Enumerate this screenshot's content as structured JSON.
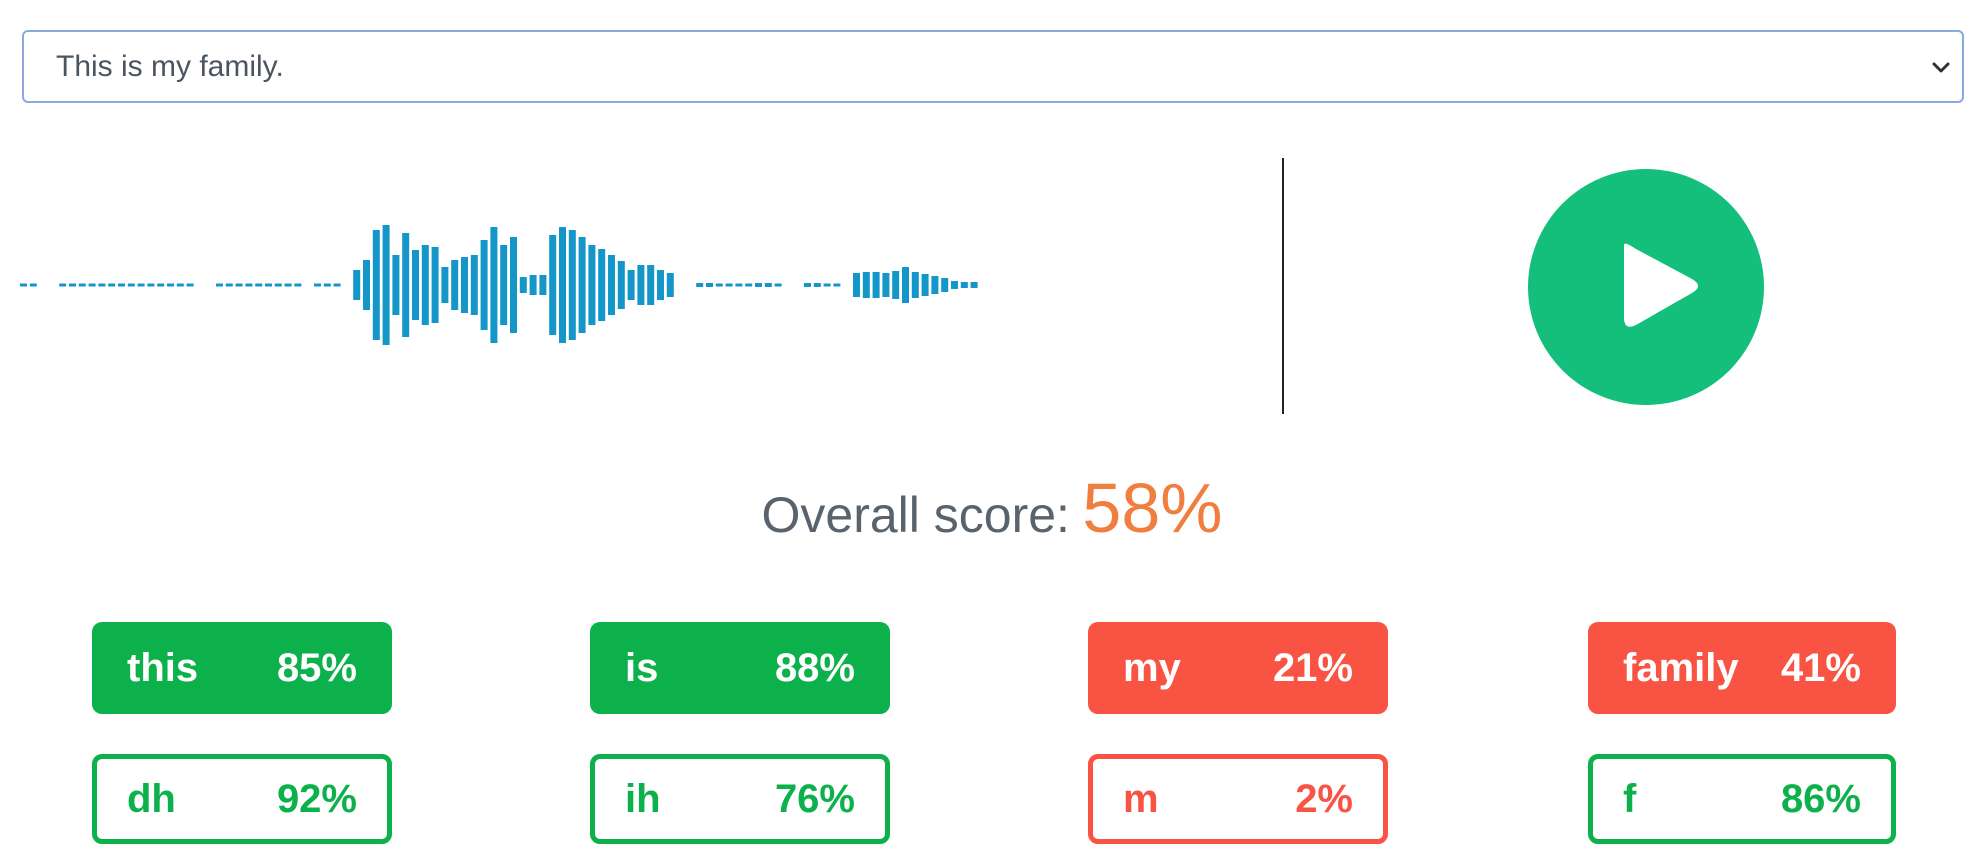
{
  "sentence_select": {
    "selected": "This is my family."
  },
  "waveform": {
    "color": "#1596c8",
    "cursor_color": "#222222"
  },
  "play_button": {
    "icon": "play-icon",
    "color": "#13bf7b"
  },
  "overall": {
    "label": "Overall score:",
    "value": "58%",
    "value_color": "#f07e3e"
  },
  "words": [
    {
      "word": "this",
      "score": "85%",
      "status": "good"
    },
    {
      "word": "is",
      "score": "88%",
      "status": "good"
    },
    {
      "word": "my",
      "score": "21%",
      "status": "bad"
    },
    {
      "word": "family",
      "score": "41%",
      "status": "bad"
    }
  ],
  "phonemes": [
    {
      "phoneme": "dh",
      "score": "92%",
      "status": "good"
    },
    {
      "phoneme": "ih",
      "score": "76%",
      "status": "good"
    },
    {
      "phoneme": "m",
      "score": "2%",
      "status": "bad"
    },
    {
      "phoneme": "f",
      "score": "86%",
      "status": "good"
    }
  ],
  "colors": {
    "good": "#0db14b",
    "bad": "#f95343"
  }
}
